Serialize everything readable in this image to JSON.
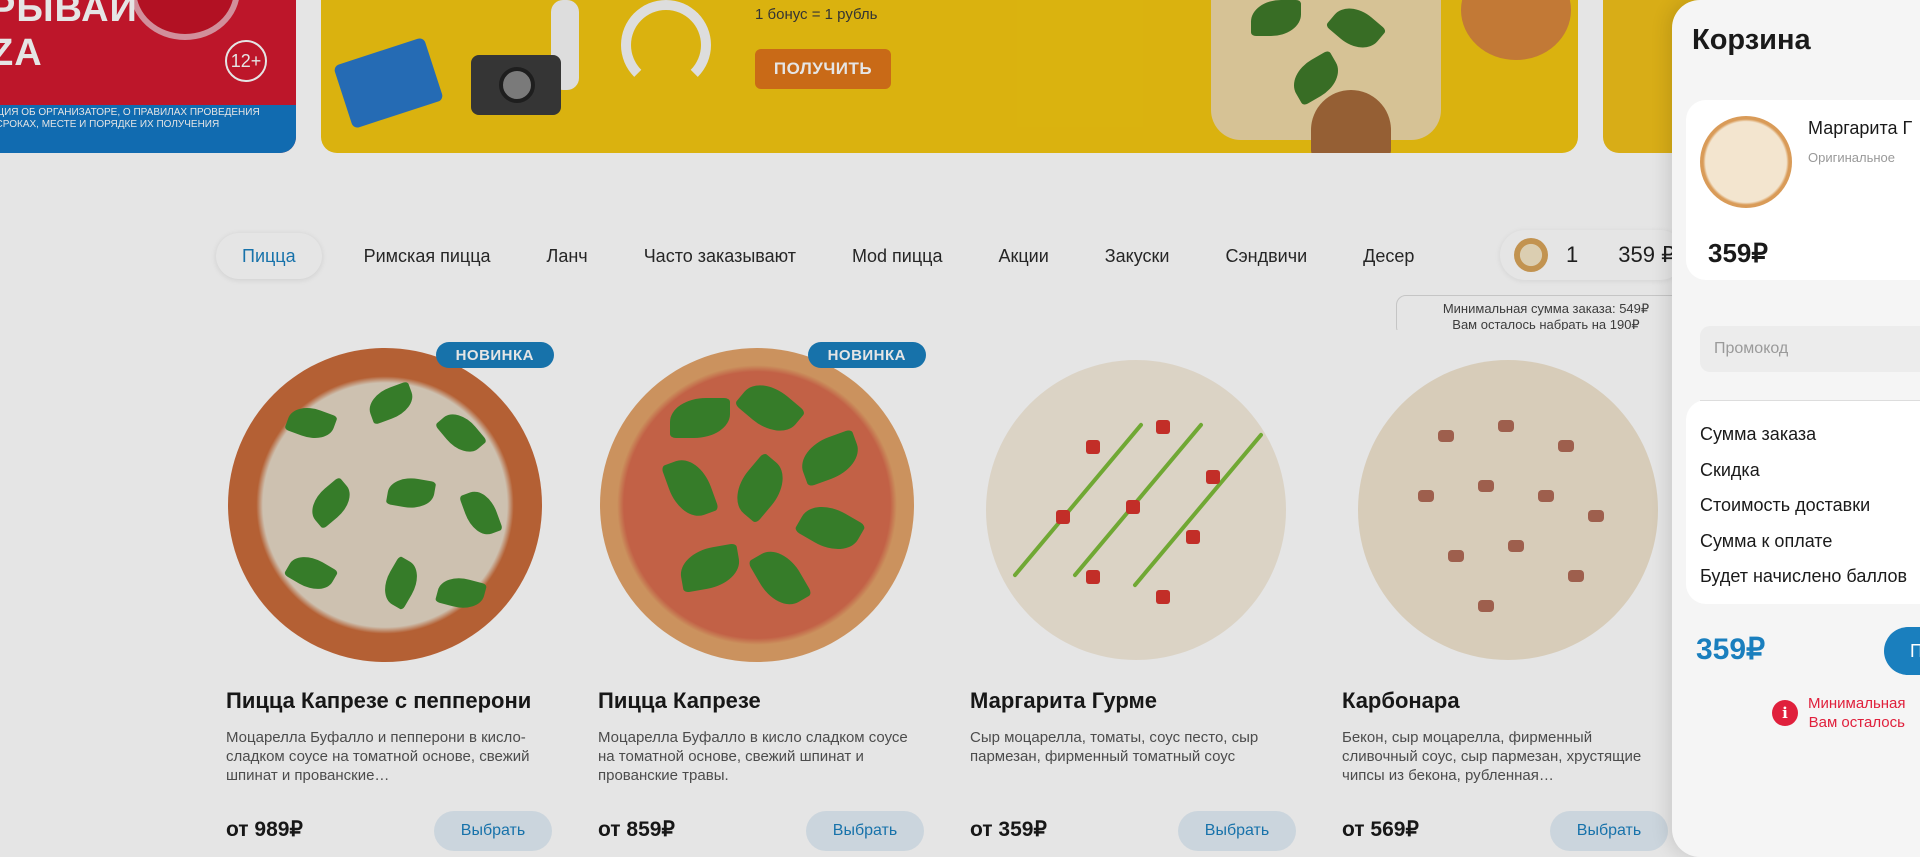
{
  "promo_banners": {
    "left": {
      "line1": "РЫВАЙ",
      "line2": "ZA",
      "age": "12+",
      "fine_print": "АЦИЯ ОБ ОРГАНИЗАТОРЕ, О ПРАВИЛАХ ПРОВЕДЕНИЯ\n, СРОКАХ, МЕСТЕ И ПОРЯДКЕ ИХ ПОЛУЧЕНИЯ"
    },
    "center": {
      "bonus_text": "1 бонус = 1 рубль",
      "button_label": "ПОЛУЧИТЬ"
    }
  },
  "categories": [
    {
      "label": "Пицца",
      "active": true
    },
    {
      "label": "Римская пицца"
    },
    {
      "label": "Ланч"
    },
    {
      "label": "Часто заказывают"
    },
    {
      "label": "Mod пицца"
    },
    {
      "label": "Акции"
    },
    {
      "label": "Закуски"
    },
    {
      "label": "Сэндвичи"
    },
    {
      "label": "Десер"
    }
  ],
  "mini_cart": {
    "quantity": "1",
    "total": "359 ₽"
  },
  "min_order_tip": {
    "line1": "Минимальная сумма заказа: 549₽",
    "line2": "Вам осталось набрать на 190₽"
  },
  "products": [
    {
      "name": "Пицца Капрезе с пепперони",
      "description": "Моцарелла Буфалло и пепперони в кисло- сладком соусе на томатной основе, свежий шпинат и прованские…",
      "price": "от 989₽",
      "button": "Выбрать",
      "badge": "НОВИНКА"
    },
    {
      "name": "Пицца Капрезе",
      "description": "Моцарелла Буфалло в кисло сладком соусе на томатной основе, свежий шпинат и прованские травы.",
      "price": "от 859₽",
      "button": "Выбрать",
      "badge": "НОВИНКА"
    },
    {
      "name": "Маргарита Гурме",
      "description": "Сыр моцарелла, томаты, соус песто, сыр пармезан, фирменный томатный соус",
      "price": "от 359₽",
      "button": "Выбрать"
    },
    {
      "name": "Карбонара",
      "description": "Бекон, сыр моцарелла, фирменный сливочный соус, сыр пармезан, хрустящие чипсы из бекона, рубленная…",
      "price": "от 569₽",
      "button": "Выбрать"
    }
  ],
  "cart": {
    "title": "Корзина",
    "item": {
      "name": "Маргарита Г",
      "dough": "Оригинальное",
      "price": "359₽"
    },
    "promo_placeholder": "Промокод",
    "summary": {
      "order_sum": "Сумма заказа",
      "discount": "Скидка",
      "delivery": "Стоимость доставки",
      "to_pay": "Сумма к оплате",
      "bonus": "Будет начислено баллов"
    },
    "final_price": "359₽",
    "checkout_label": "П",
    "warning_line1": "Минимальная",
    "warning_line2": "Вам осталось"
  },
  "colors": {
    "accent": "#1a7fbe",
    "warning": "#e0203c",
    "promo_orange": "#e0761a",
    "banner_red": "#d3192f",
    "banner_yellow": "#f3c711"
  }
}
